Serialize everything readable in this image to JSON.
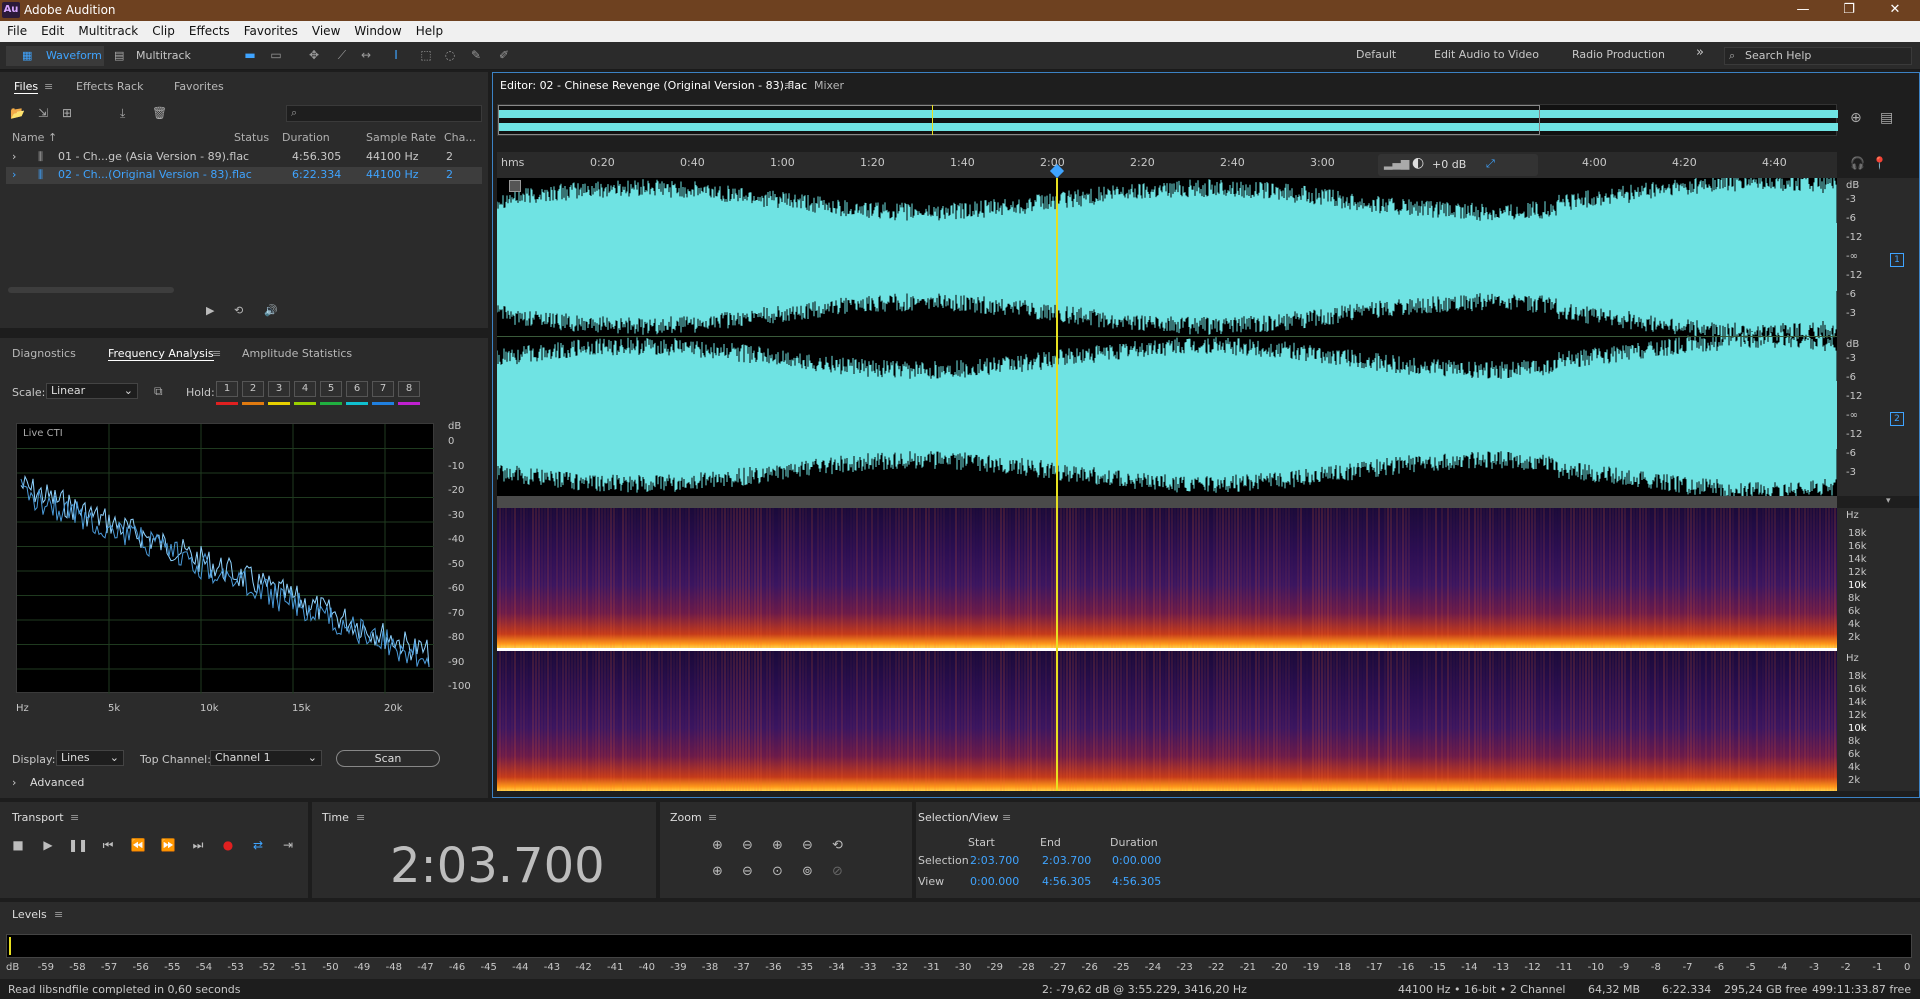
{
  "titlebar": {
    "logo": "Au",
    "title": "Adobe Audition",
    "min": "—",
    "max": "❐",
    "close": "✕"
  },
  "menu": [
    "File",
    "Edit",
    "Multitrack",
    "Clip",
    "Effects",
    "Favorites",
    "View",
    "Window",
    "Help"
  ],
  "toolbar": {
    "waveform_label": "Waveform",
    "multitrack_label": "Multitrack",
    "workspaces": [
      "Default",
      "Edit Audio to Video",
      "Radio Production"
    ],
    "more": "»",
    "search_placeholder": "Search Help"
  },
  "files_panel": {
    "tabs": [
      "Files",
      "Effects Rack",
      "Favorites"
    ],
    "search_placeholder": "",
    "columns": [
      "Name ↑",
      "Status",
      "Duration",
      "Sample Rate",
      "Cha..."
    ],
    "rows": [
      {
        "name": "01 - Ch...ge (Asia Version - 89).flac",
        "status": "",
        "duration": "4:56.305",
        "rate": "44100 Hz",
        "channels": "2"
      },
      {
        "name": "02 - Ch...(Original Version - 83).flac",
        "status": "",
        "duration": "6:22.334",
        "rate": "44100 Hz",
        "channels": "2"
      }
    ]
  },
  "analysis_panel": {
    "tabs": [
      "Diagnostics",
      "Frequency Analysis",
      "Amplitude Statistics"
    ],
    "scale_label": "Scale:",
    "scale_value": "Linear",
    "hold_label": "Hold:",
    "holds": [
      "1",
      "2",
      "3",
      "4",
      "5",
      "6",
      "7",
      "8"
    ],
    "hold_colors": [
      "#e02020",
      "#e07a10",
      "#e8d000",
      "#9ad000",
      "#20b040",
      "#10c0d0",
      "#2080e0",
      "#c020d0"
    ],
    "live_cti": "Live CTI",
    "y_unit": "dB",
    "y_ticks": [
      "0",
      "-10",
      "-20",
      "-30",
      "-40",
      "-50",
      "-60",
      "-70",
      "-80",
      "-90",
      "-100"
    ],
    "x_ticks": [
      "Hz",
      "5k",
      "10k",
      "15k",
      "20k"
    ],
    "display_label": "Display:",
    "display_value": "Lines",
    "top_channel_label": "Top Channel:",
    "top_channel_value": "Channel 1",
    "scan_label": "Scan",
    "advanced_label": "Advanced"
  },
  "editor": {
    "tab_label": "Editor: 02 - Chinese Revenge (Original Version - 83).flac",
    "mixer_label": "Mixer",
    "ruler_unit": "hms",
    "ruler_ticks": [
      "0:20",
      "0:40",
      "1:00",
      "1:20",
      "1:40",
      "2:00",
      "2:20",
      "2:40",
      "3:00",
      "4:00",
      "4:20",
      "4:40"
    ],
    "gain_label": "+0 dB",
    "db_unit": "dB",
    "db_ticks": [
      "-3",
      "-6",
      "-12",
      "-∞",
      "-12",
      "-6",
      "-3"
    ],
    "channel_numbers": [
      "1",
      "2"
    ],
    "hz_unit": "Hz",
    "hz_ticks": [
      "18k",
      "16k",
      "14k",
      "12k",
      "10k",
      "8k",
      "6k",
      "4k",
      "2k"
    ]
  },
  "transport": {
    "title": "Transport",
    "buttons": [
      "■",
      "▶",
      "❚❚",
      "⏮",
      "⏪",
      "⏩",
      "⏭",
      "●",
      "⇄",
      "⇥"
    ]
  },
  "time_panel": {
    "title": "Time",
    "value": "2:03.700"
  },
  "zoom_panel": {
    "title": "Zoom"
  },
  "selection_view": {
    "title": "Selection/View",
    "headers": [
      "Start",
      "End",
      "Duration"
    ],
    "selection_label": "Selection",
    "view_label": "View",
    "selection": [
      "2:03.700",
      "2:03.700",
      "0:00.000"
    ],
    "view": [
      "0:00.000",
      "4:56.305",
      "4:56.305"
    ]
  },
  "levels": {
    "title": "Levels",
    "ticks": [
      "dB",
      "-59",
      "-58",
      "-57",
      "-56",
      "-55",
      "-54",
      "-53",
      "-52",
      "-51",
      "-50",
      "-49",
      "-48",
      "-47",
      "-46",
      "-45",
      "-44",
      "-43",
      "-42",
      "-41",
      "-40",
      "-39",
      "-38",
      "-37",
      "-36",
      "-35",
      "-34",
      "-33",
      "-32",
      "-31",
      "-30",
      "-29",
      "-28",
      "-27",
      "-26",
      "-25",
      "-24",
      "-23",
      "-22",
      "-21",
      "-20",
      "-19",
      "-18",
      "-17",
      "-16",
      "-15",
      "-14",
      "-13",
      "-12",
      "-11",
      "-10",
      "-9",
      "-8",
      "-7",
      "-6",
      "-5",
      "-4",
      "-3",
      "-2",
      "-1",
      "0"
    ]
  },
  "status": {
    "message": "Read libsndfile completed in 0,60 seconds",
    "cursor": "2: -79,62 dB @ 3:55.229, 3416,20 Hz",
    "format": "44100 Hz • 16-bit • 2 Channel",
    "size": "64,32 MB",
    "duration": "6:22.334",
    "free": "295,24 GB free",
    "free_time": "499:11:33.87 free"
  },
  "colors": {
    "waveform": "#6fe3e3",
    "playhead": "#e8e020",
    "selection_blue": "#3fa4ff",
    "titlebar": "#6e4120"
  }
}
